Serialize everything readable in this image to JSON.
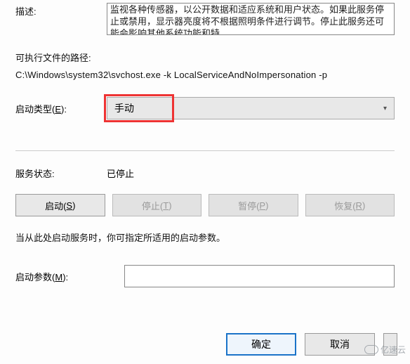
{
  "description": {
    "label": "描述:",
    "text": "监视各种传感器，以公开数据和适应系统和用户状态。如果此服务停止或禁用，显示器亮度将不根据照明条件进行调节。停止此服务还可能会影响其他系统功能和特"
  },
  "exe_path": {
    "label": "可执行文件的路径:",
    "value": "C:\\Windows\\system32\\svchost.exe -k LocalServiceAndNoImpersonation -p"
  },
  "startup_type": {
    "label_prefix": "启动类型(",
    "label_key": "E",
    "label_suffix": "):",
    "selected": "手动"
  },
  "service_status": {
    "label": "服务状态:",
    "value": "已停止"
  },
  "buttons": {
    "start_prefix": "启动(",
    "start_key": "S",
    "start_suffix": ")",
    "stop_prefix": "停止(",
    "stop_key": "T",
    "stop_suffix": ")",
    "pause_prefix": "暂停(",
    "pause_key": "P",
    "pause_suffix": ")",
    "resume_prefix": "恢复(",
    "resume_key": "R",
    "resume_suffix": ")"
  },
  "help_text": "当从此处启动服务时，你可指定所适用的启动参数。",
  "start_params": {
    "label_prefix": "启动参数(",
    "label_key": "M",
    "label_suffix": "):",
    "value": ""
  },
  "dialog": {
    "ok": "确定",
    "cancel": "取消"
  },
  "watermark": "亿速云"
}
